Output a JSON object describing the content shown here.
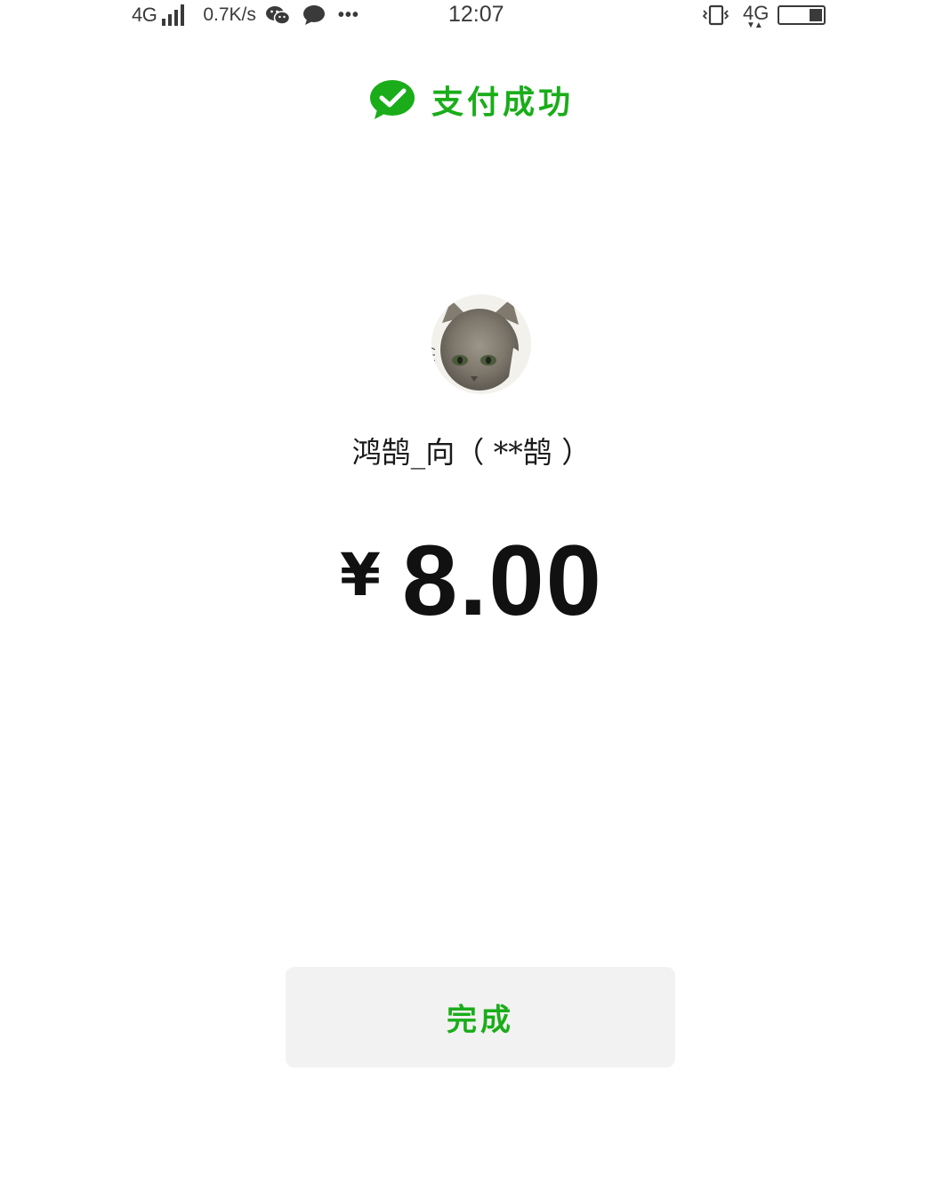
{
  "status_bar": {
    "network_left": "4G",
    "net_speed": "0.7K/s",
    "more": "•••",
    "time": "12:07",
    "network_right": "4G",
    "network_right_arrows": "▼▲",
    "battery_level": 0.3,
    "icons": [
      "signal-icon",
      "wechat-icon",
      "chat-bubble-icon",
      "more-icon",
      "vibrate-icon",
      "battery-icon"
    ]
  },
  "header": {
    "title": "支付成功",
    "icon": "check-bubble-icon"
  },
  "payee": {
    "name": "鸿鹄_向（ **鹄 ）",
    "avatar": "cat-avatar"
  },
  "amount": {
    "currency": "¥",
    "value": "8.00"
  },
  "actions": {
    "done_label": "完成"
  },
  "colors": {
    "accent": "#1aad19",
    "button_bg": "#f2f2f2",
    "text": "#111111",
    "background": "#ffffff"
  }
}
